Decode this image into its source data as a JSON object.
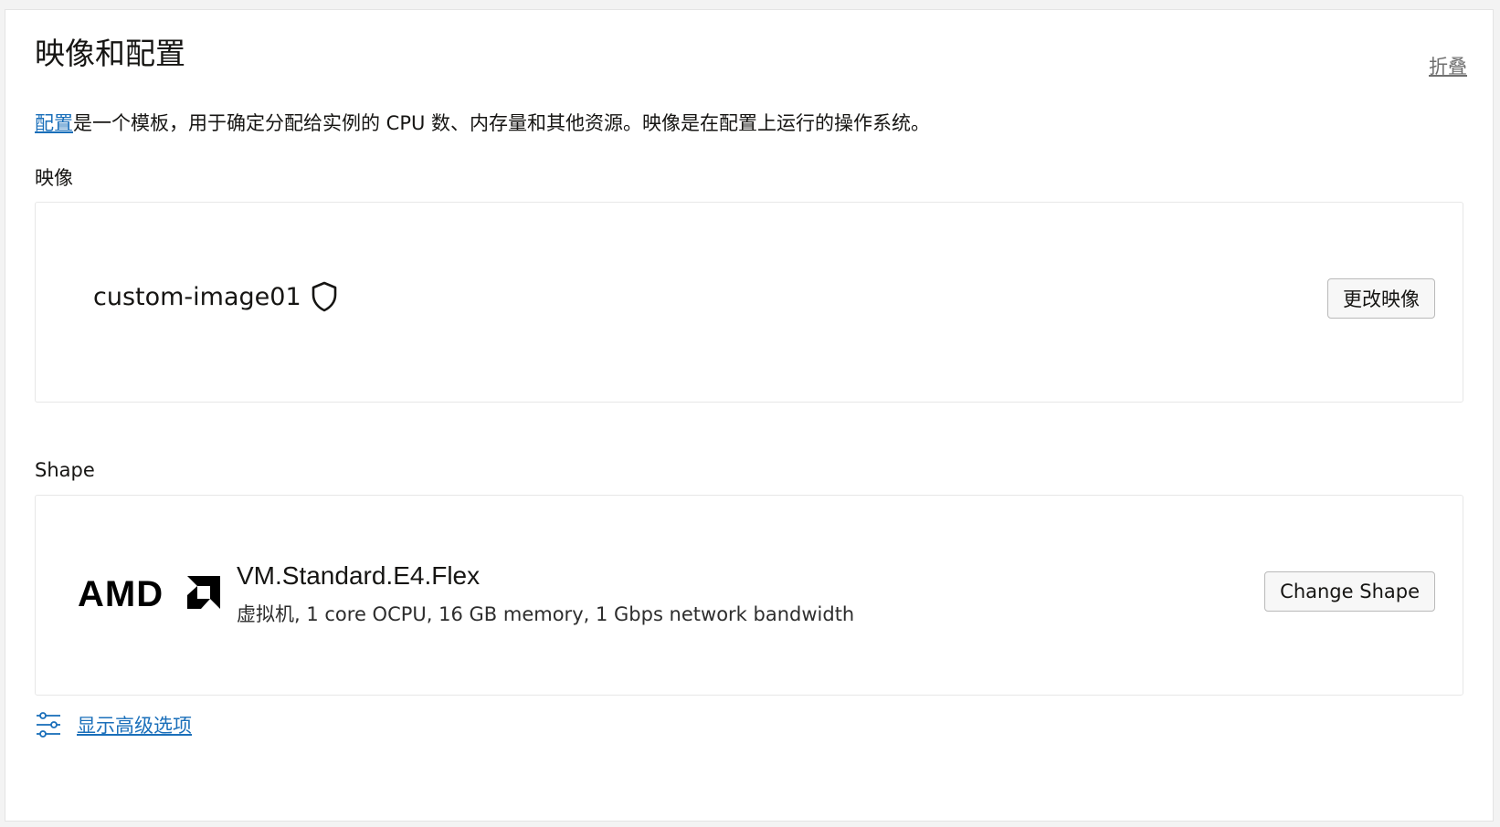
{
  "header": {
    "title": "映像和配置",
    "collapse_label": "折叠"
  },
  "intro": {
    "link_text": "配置",
    "text": "是一个模板，用于确定分配给实例的 CPU 数、内存量和其他资源。映像是在配置上运行的操作系统。"
  },
  "image_section": {
    "label": "映像",
    "image_name": "custom-image01",
    "icon": "shield-icon",
    "change_button": "更改映像"
  },
  "shape_section": {
    "label": "Shape",
    "vendor_logo": "AMD",
    "shape_name": "VM.Standard.E4.Flex",
    "description": "虚拟机, 1 core OCPU, 16 GB memory, 1 Gbps network bandwidth",
    "change_button": "Change Shape"
  },
  "advanced": {
    "icon": "sliders-icon",
    "label": "显示高级选项"
  },
  "colors": {
    "link": "#1a6fba",
    "text": "#161513",
    "muted": "#6f6f6f",
    "border": "#e7e7e7"
  }
}
